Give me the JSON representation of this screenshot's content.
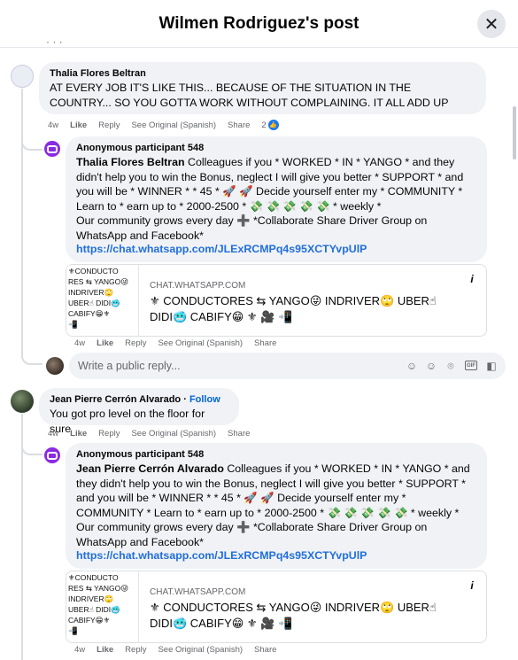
{
  "header": {
    "title": "Wilmen Rodriguez's post",
    "close_icon": "close-icon"
  },
  "comments": [
    {
      "author": "Thalia Flores Beltran",
      "text": "AT EVERY JOB IT'S LIKE THIS... BECAUSE OF THE SITUATION IN THE COUNTRY... SO YOU GOTTA WORK WITHOUT COMPLAINING. IT ALL ADD UP",
      "time": "4w",
      "like": "Like",
      "reply": "Reply",
      "see_original": "See Original (Spanish)",
      "share": "Share",
      "reactions": "2"
    },
    {
      "author": "Jean Pierre Cerrón Alvarado",
      "follow": "Follow",
      "text": "You got pro level on the floor for sure",
      "time": "4w",
      "like": "Like",
      "reply": "Reply",
      "see_original": "See Original (Spanish)",
      "share": "Share"
    }
  ],
  "replies": [
    {
      "author": "Anonymous participant 548",
      "mention": "Thalia Flores Beltran",
      "text": "Colleagues if you * WORKED * IN * YANGO * and they didn't help you to win the Bonus, neglect I will give you better * SUPPORT * and you will be * WINNER * * 45 * 🚀 🚀 Decide yourself enter my * COMMUNITY * Learn to * earn up to * 2000-2500 * 💸 💸 💸 💸 💸 * weekly *",
      "text2": "Our community grows every day ➕ *Collaborate Share Driver Group on WhatsApp and Facebook*",
      "link": "https://chat.whatsapp.com/JLExRCMPq4s95XCTYvpUlP",
      "preview": {
        "thumb": "⚜CONDUCTO\nRES ⇆ YANGO😜\nINDRIVER🙄\nUBER☝ DIDI🥶\nCABIFY😁⚜\n📲",
        "domain": "CHAT.WHATSAPP.COM",
        "title": "⚜ CONDUCTORES ⇆ YANGO😜 INDRIVER🙄 UBER☝ DIDI🥶 CABIFY😁 ⚜ 🎥 📲"
      },
      "time": "4w",
      "like": "Like",
      "reply": "Reply",
      "see_original": "See Original (Spanish)",
      "share": "Share"
    },
    {
      "author": "Anonymous participant 548",
      "mention": "Jean Pierre Cerrón Alvarado",
      "text": "Colleagues if you * WORKED * IN * YANGO * and they didn't help you to win the Bonus, neglect I will give you better * SUPPORT * and you will be * WINNER * * 45 * 🚀 🚀 Decide yourself enter my * COMMUNITY * Learn to * earn up to * 2000-2500 * 💸 💸 💸 💸 💸 * weekly *",
      "text2": "Our community grows every day ➕ *Collaborate Share Driver Group on WhatsApp and Facebook*",
      "link": "https://chat.whatsapp.com/JLExRCMPq4s95XCTYvpUlP",
      "preview": {
        "thumb": "⚜CONDUCTO\nRES ⇆ YANGO😜\nINDRIVER🙄\nUBER☝ DIDI🥶\nCABIFY😁⚜\n📲",
        "domain": "CHAT.WHATSAPP.COM",
        "title": "⚜ CONDUCTORES ⇆ YANGO😜 INDRIVER🙄 UBER☝ DIDI🥶 CABIFY😁 ⚜ 🎥 📲"
      },
      "time": "4w",
      "like": "Like",
      "reply": "Reply",
      "see_original": "See Original (Spanish)",
      "share": "Share"
    }
  ],
  "reply_box": {
    "placeholder": "Write a public reply...",
    "tools": [
      "avatar-sticker-icon",
      "emoji-icon",
      "camera-icon",
      "gif-icon",
      "sticker-icon"
    ]
  }
}
